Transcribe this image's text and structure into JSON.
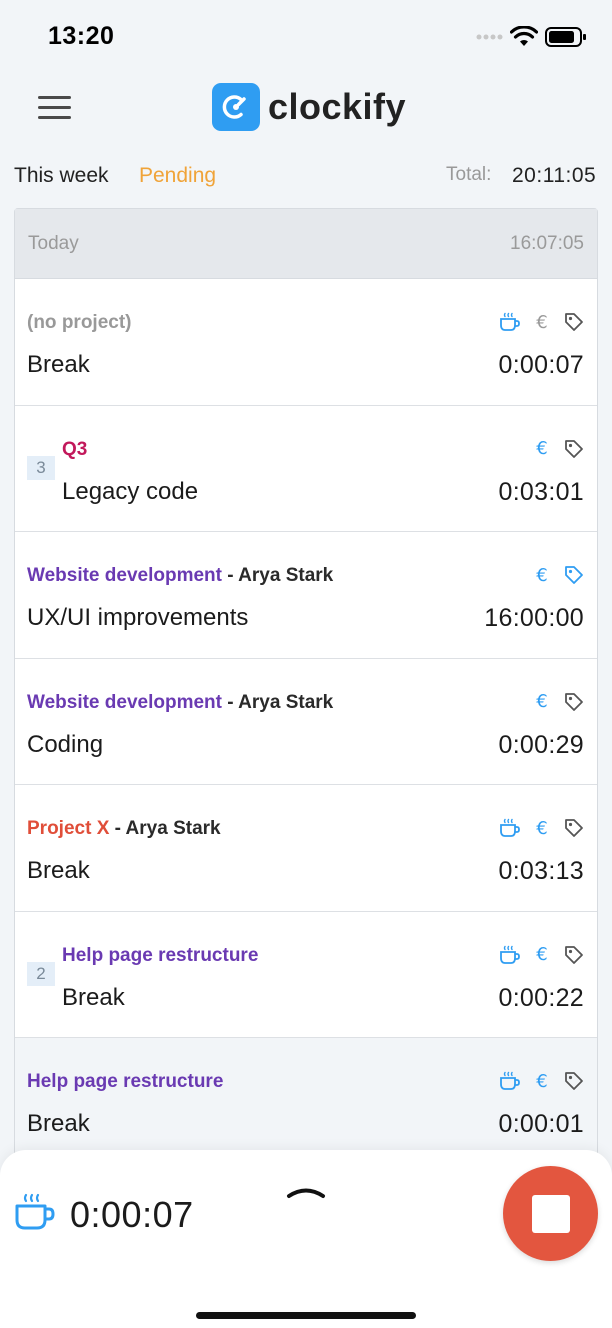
{
  "status_bar": {
    "time": "13:20"
  },
  "header": {
    "logo_text": "clockify"
  },
  "summary": {
    "period_label": "This week",
    "status_label": "Pending",
    "total_label": "Total:",
    "total_value": "20:11:05"
  },
  "day": {
    "label": "Today",
    "total": "16:07:05"
  },
  "entries": [
    {
      "project": "(no project)",
      "project_color": "#999999",
      "client": "",
      "description": "Break",
      "duration": "0:00:07",
      "group_count": "",
      "icons": {
        "break": true,
        "euro_color": "#9a9a9a",
        "tag_color": "#555555"
      }
    },
    {
      "project": "Q3",
      "project_color": "#c2185b",
      "client": "",
      "description": "Legacy code",
      "duration": "0:03:01",
      "group_count": "3",
      "icons": {
        "break": false,
        "euro_color": "#2f9df2",
        "tag_color": "#555555"
      }
    },
    {
      "project": "Website development",
      "project_color": "#6a3ab2",
      "client": " - Arya Stark",
      "description": "UX/UI improvements",
      "duration": "16:00:00",
      "group_count": "",
      "icons": {
        "break": false,
        "euro_color": "#2f9df2",
        "tag_color": "#2f9df2"
      }
    },
    {
      "project": "Website development",
      "project_color": "#6a3ab2",
      "client": " - Arya Stark",
      "description": "Coding",
      "duration": "0:00:29",
      "group_count": "",
      "icons": {
        "break": false,
        "euro_color": "#2f9df2",
        "tag_color": "#555555"
      }
    },
    {
      "project": "Project X",
      "project_color": "#e04e39",
      "client": " - Arya Stark",
      "description": "Break",
      "duration": "0:03:13",
      "group_count": "",
      "icons": {
        "break": true,
        "euro_color": "#2f9df2",
        "tag_color": "#555555"
      }
    },
    {
      "project": "Help page restructure",
      "project_color": "#6a3ab2",
      "client": "",
      "description": "Break",
      "duration": "0:00:22",
      "group_count": "2",
      "icons": {
        "break": true,
        "euro_color": "#2f9df2",
        "tag_color": "#555555"
      }
    },
    {
      "project": "Help page restructure",
      "project_color": "#6a3ab2",
      "client": "",
      "description": "Break",
      "duration": "0:00:01",
      "group_count": "",
      "icons": {
        "break": true,
        "euro_color": "#2f9df2",
        "tag_color": "#555555"
      }
    }
  ],
  "timer": {
    "value": "0:00:07"
  },
  "colors": {
    "accent": "#2f9df2",
    "pending": "#f0a338",
    "stop": "#e3563f"
  }
}
